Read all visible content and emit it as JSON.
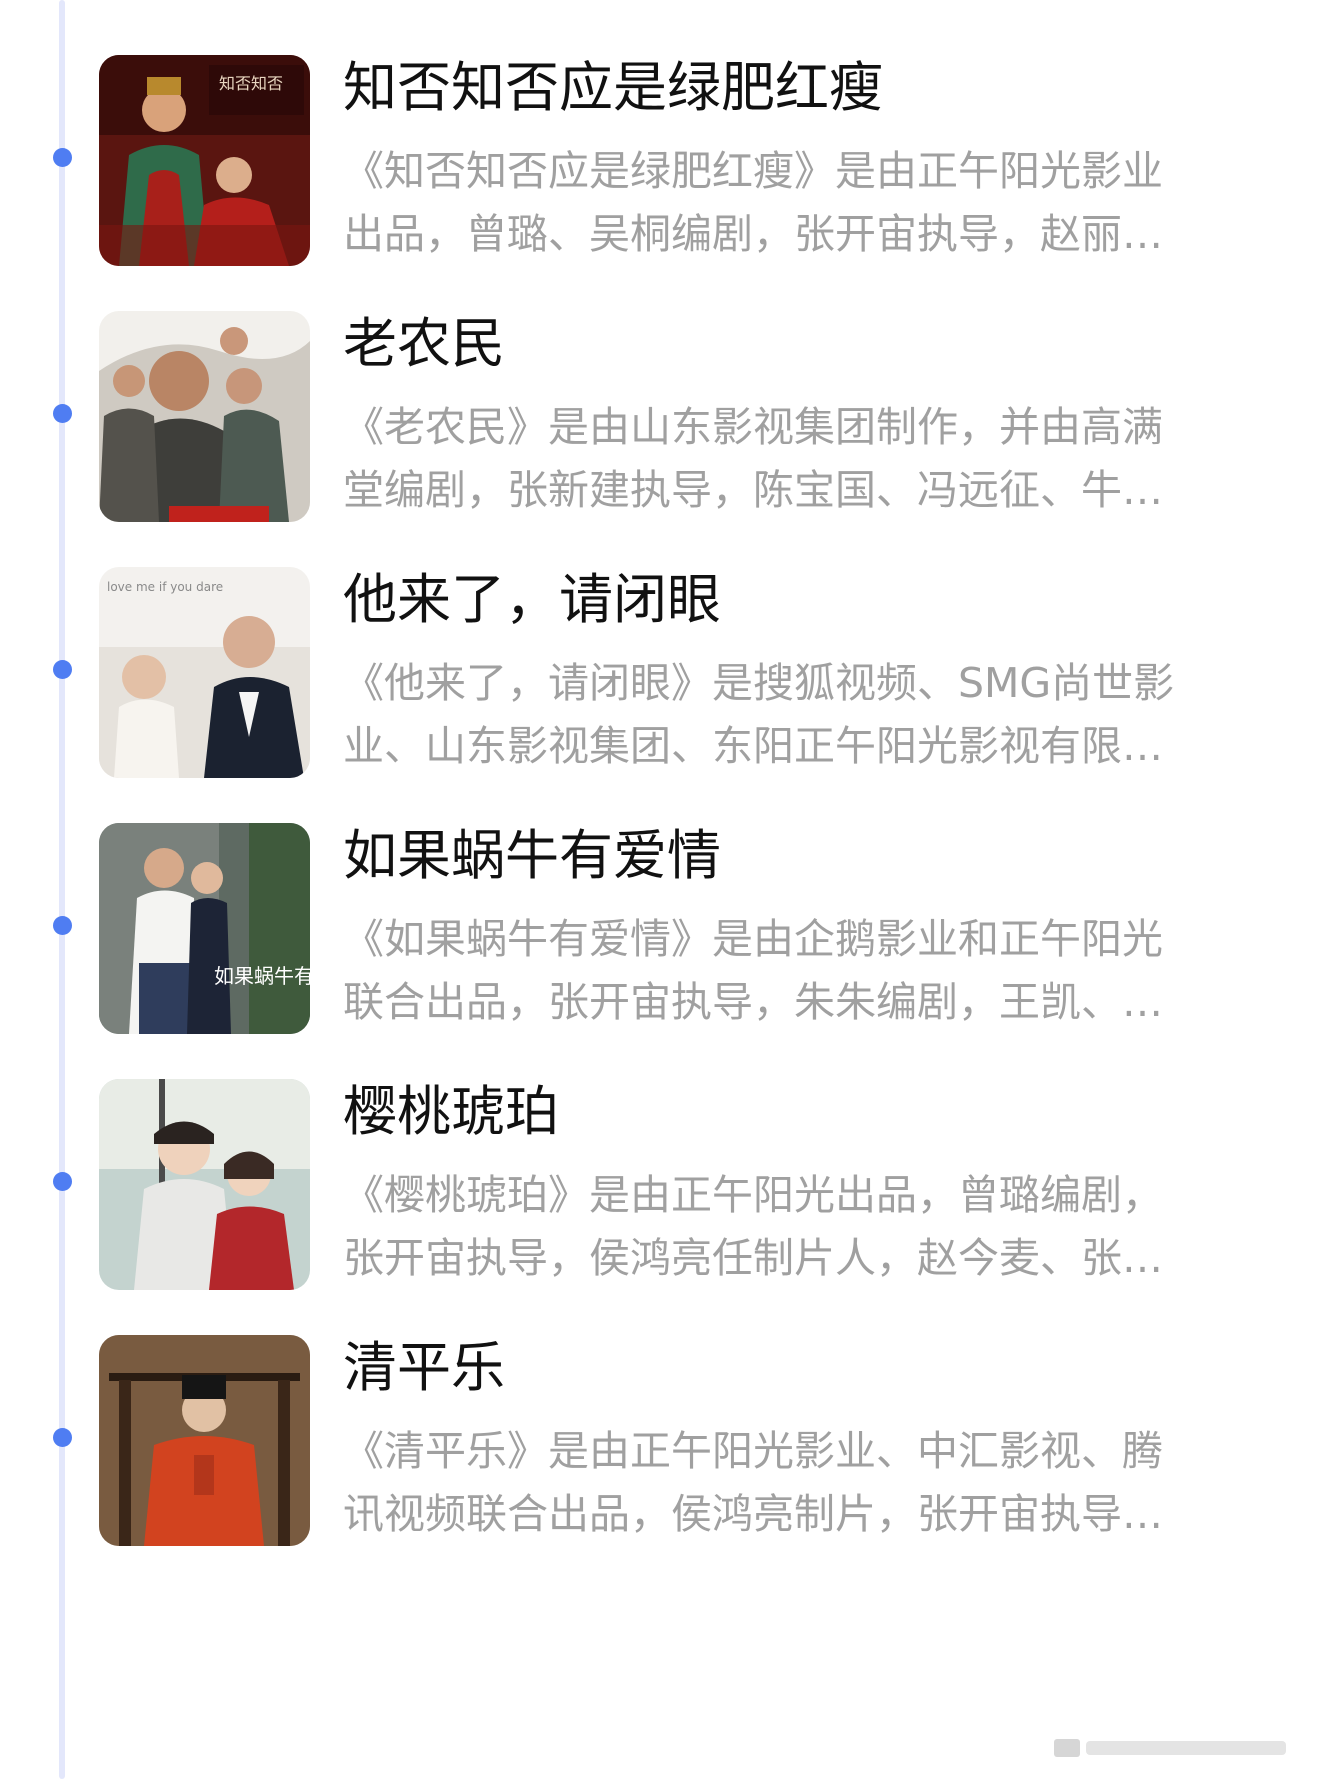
{
  "items": [
    {
      "title": "知否知否应是绿肥红瘦",
      "desc_line1": "《知否知否应是绿肥红瘦》是由正午阳光影业",
      "desc_line2": "出品，曾璐、吴桐编剧，张开宙执导，赵丽…",
      "poster_text": "知否知否"
    },
    {
      "title": "老农民",
      "desc_line1": "《老农民》是由山东影视集团制作，并由高满",
      "desc_line2": "堂编剧，张新建执导，陈宝国、冯远征、牛…"
    },
    {
      "title": "他来了，请闭眼",
      "desc_line1": "《他来了，请闭眼》是搜狐视频、SMG尚世影",
      "desc_line2": "业、山东影视集团、东阳正午阳光影视有限…",
      "poster_text": "love me if you dare"
    },
    {
      "title": "如果蜗牛有爱情",
      "desc_line1": "《如果蜗牛有爱情》是由企鹅影业和正午阳光",
      "desc_line2": "联合出品，张开宙执导，朱朱编剧，王凯、…",
      "poster_text": "如果蜗牛有爱情"
    },
    {
      "title": "樱桃琥珀",
      "desc_line1": "《樱桃琥珀》是由正午阳光出品，曾璐编剧，",
      "desc_line2": "张开宙执导，侯鸿亮任制片人，赵今麦、张…"
    },
    {
      "title": "清平乐",
      "desc_line1": "《清平乐》是由正午阳光影业、中汇影视、腾",
      "desc_line2": "讯视频联合出品，侯鸿亮制片，张开宙执导…"
    }
  ],
  "colors": {
    "timeline": "#e3e7fb",
    "dot": "#4f7df2",
    "title": "#111111",
    "desc": "#a0a0a0"
  }
}
